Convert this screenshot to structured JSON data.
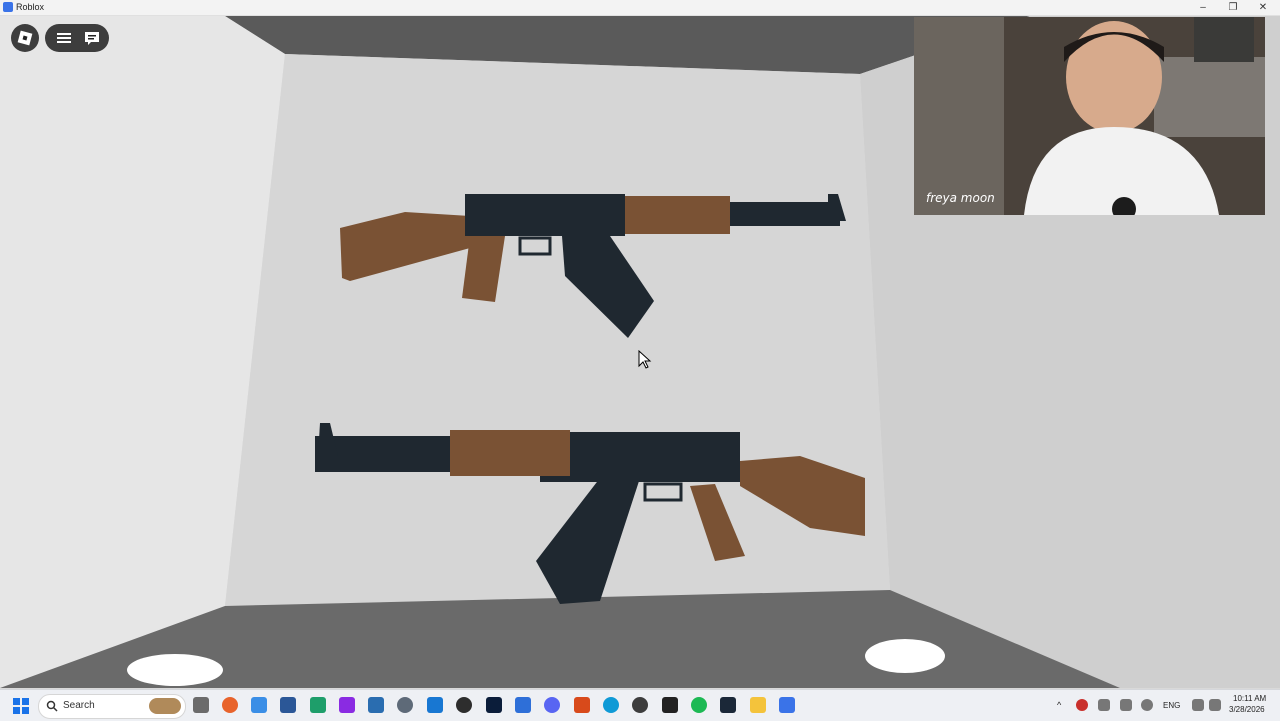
{
  "window": {
    "title": "Roblox"
  },
  "webcam": {
    "label": "freya moon"
  },
  "taskbar": {
    "search_label": "Search",
    "language": "ENG",
    "time": "10:11 AM",
    "date": "3/28/2026"
  },
  "icons": {
    "start": "windows-start-icon",
    "search": "search-icon",
    "roblox_menu": "roblox-logo-icon",
    "menu": "hamburger-menu-icon",
    "chat": "chat-icon"
  }
}
